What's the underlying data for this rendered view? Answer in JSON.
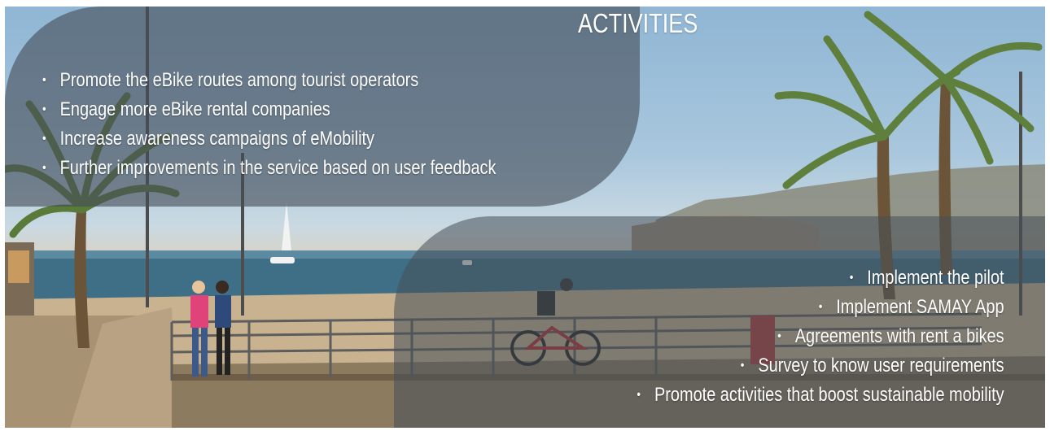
{
  "slide": {
    "title": "ACTIVITIES",
    "left_list": [
      "Promote the eBike routes among tourist operators",
      "Engage more eBike rental companies",
      "Increase awareness campaigns of eMobility",
      "Further improvements in the service based on user feedback"
    ],
    "right_list": [
      "Implement the pilot",
      "Implement SAMAY App",
      "Agreements with rent a bikes",
      "Survey to know user requirements",
      "Promote activities that boost sustainable mobility"
    ]
  }
}
